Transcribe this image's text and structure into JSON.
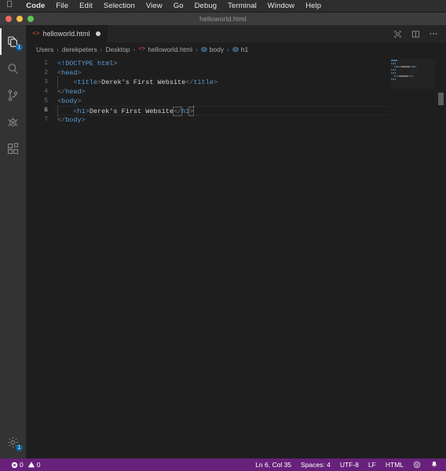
{
  "menubar": {
    "apple_icon": "apple-logo-icon",
    "items": [
      {
        "label": "Code",
        "bold": true
      },
      {
        "label": "File",
        "bold": false
      },
      {
        "label": "Edit",
        "bold": false
      },
      {
        "label": "Selection",
        "bold": false
      },
      {
        "label": "View",
        "bold": false
      },
      {
        "label": "Go",
        "bold": false
      },
      {
        "label": "Debug",
        "bold": false
      },
      {
        "label": "Terminal",
        "bold": false
      },
      {
        "label": "Window",
        "bold": false
      },
      {
        "label": "Help",
        "bold": false
      }
    ]
  },
  "titlebar": {
    "title": "helloworld.html"
  },
  "activitybar": {
    "items": [
      {
        "name": "explorer",
        "icon": "files-icon",
        "badge": "1",
        "active": true
      },
      {
        "name": "search",
        "icon": "search-icon",
        "badge": "",
        "active": false
      },
      {
        "name": "source-control",
        "icon": "source-control-icon",
        "badge": "",
        "active": false
      },
      {
        "name": "run-and-debug",
        "icon": "debug-icon",
        "badge": "",
        "active": false
      },
      {
        "name": "extensions",
        "icon": "extensions-icon",
        "badge": "",
        "active": false
      }
    ],
    "manage": {
      "name": "manage",
      "icon": "gear-icon",
      "badge": "1"
    }
  },
  "tabs": [
    {
      "label": "helloworld.html",
      "icon": "html-tag-icon",
      "dirty": true,
      "active": true
    }
  ],
  "editor_actions": [
    {
      "name": "open-preview",
      "icon": "open-preview-icon"
    },
    {
      "name": "split-editor",
      "icon": "split-editor-icon"
    },
    {
      "name": "more-actions",
      "icon": "ellipsis-icon"
    }
  ],
  "breadcrumbs": [
    {
      "label": "Users",
      "icon": ""
    },
    {
      "label": "derekpeters",
      "icon": ""
    },
    {
      "label": "Desktop",
      "icon": ""
    },
    {
      "label": "helloworld.html",
      "icon": "html-tag-icon"
    },
    {
      "label": "body",
      "icon": "symbol-field-icon"
    },
    {
      "label": "h1",
      "icon": "symbol-field-icon"
    }
  ],
  "breadcrumb_separator": "›",
  "code": {
    "language": "HTML",
    "lines": [
      {
        "num": "1",
        "indent": 0,
        "tokens": [
          {
            "t": "<!DOCTYPE html>",
            "c": "t-doct"
          }
        ]
      },
      {
        "num": "2",
        "indent": 0,
        "tokens": [
          {
            "t": "<",
            "c": "t-br"
          },
          {
            "t": "head",
            "c": "t-tag"
          },
          {
            "t": ">",
            "c": "t-br"
          }
        ]
      },
      {
        "num": "3",
        "indent": 1,
        "tokens": [
          {
            "t": "<",
            "c": "t-br"
          },
          {
            "t": "title",
            "c": "t-tag"
          },
          {
            "t": ">",
            "c": "t-br"
          },
          {
            "t": "Derek's First Website",
            "c": "t-txt"
          },
          {
            "t": "</",
            "c": "t-br"
          },
          {
            "t": "title",
            "c": "t-tag"
          },
          {
            "t": ">",
            "c": "t-br"
          }
        ]
      },
      {
        "num": "4",
        "indent": 0,
        "tokens": [
          {
            "t": "</",
            "c": "t-br"
          },
          {
            "t": "head",
            "c": "t-tag"
          },
          {
            "t": ">",
            "c": "t-br"
          }
        ]
      },
      {
        "num": "5",
        "indent": 0,
        "tokens": [
          {
            "t": "<",
            "c": "t-br"
          },
          {
            "t": "body",
            "c": "t-tag"
          },
          {
            "t": ">",
            "c": "t-br"
          }
        ]
      },
      {
        "num": "6",
        "indent": 1,
        "current": true,
        "tokens": [
          {
            "t": "<",
            "c": "t-br"
          },
          {
            "t": "h1",
            "c": "t-tag"
          },
          {
            "t": ">",
            "c": "t-br"
          },
          {
            "t": "Derek's First Website",
            "c": "t-txt"
          },
          {
            "t": "</",
            "c": "t-br brmatch"
          },
          {
            "t": "h1",
            "c": "t-tag"
          },
          {
            "t": ">",
            "c": "t-br brmatch"
          }
        ]
      },
      {
        "num": "7",
        "indent": 0,
        "tokens": [
          {
            "t": "</",
            "c": "t-br"
          },
          {
            "t": "body",
            "c": "t-tag"
          },
          {
            "t": ">",
            "c": "t-br"
          }
        ]
      }
    ],
    "raw_text": "<!DOCTYPE html>\n<head>\n    <title>Derek's First Website</title>\n</head>\n<body>\n    <h1>Derek's First Website</h1>\n</body>"
  },
  "statusbar": {
    "errors_icon": "error-icon",
    "errors": "0",
    "warnings_icon": "warning-icon",
    "warnings": "0",
    "position": "Ln 6, Col 35",
    "indentation": "Spaces: 4",
    "encoding": "UTF-8",
    "eol": "LF",
    "language": "HTML",
    "feedback_icon": "smiley-icon",
    "notifications_icon": "bell-icon",
    "background": "#68217a"
  },
  "colors": {
    "editor_bg": "#1e1e1e",
    "sidebar_bg": "#333333",
    "tabbar_bg": "#252526",
    "statusbar_bg": "#68217a",
    "tag_blue": "#569cd6",
    "text_white": "#d4d4d4",
    "bracket_gray": "#808080",
    "badge_blue": "#0e639c"
  }
}
